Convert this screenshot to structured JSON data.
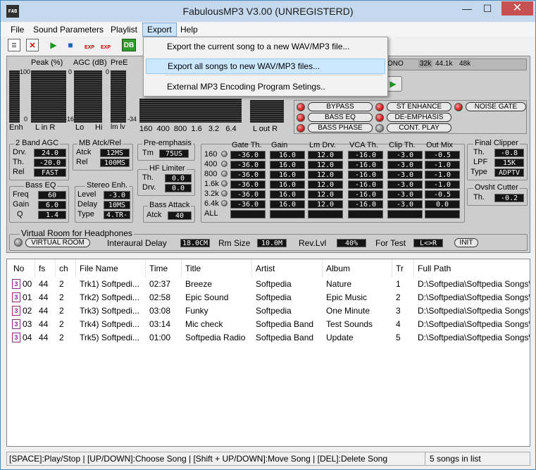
{
  "window": {
    "title": "FabulousMP3 V3.00 (UNREGISTERD)",
    "icon_text": "FAB",
    "minimize": "—",
    "maximize": "☐",
    "close": "✕"
  },
  "menu": {
    "file": "File",
    "sound": "Sound Parameters",
    "playlist": "Playlist",
    "export": "Export",
    "help": "Help"
  },
  "export_menu": {
    "item1": "Export the current song to a new WAV/MP3 file...",
    "item2": "Export all songs to new WAV/MP3 files...",
    "item3": "External MP3 Encoding Program Setings.."
  },
  "toolbar": {
    "db": "DB",
    "exp": "EXP"
  },
  "meters": {
    "peak": "Peak (%)",
    "agc": "AGC (dB)",
    "pree": "PreE",
    "s100": "100",
    "s0": "0",
    "sm16": "-16",
    "sm34": "-34",
    "enh": "Enh",
    "lin": "L  in  R",
    "lo": "Lo",
    "hi": "Hi",
    "lmlv": "lm lv",
    "bands": "160  400  800  1.6   3.2   6.4",
    "lout": "L  out  R",
    "mono": "ONO",
    "r32": "32k",
    "r441": "44.1k",
    "r48": "48k"
  },
  "switches": {
    "bypass": "BYPASS",
    "st_enhance": "ST ENHANCE",
    "noise_gate": "NOISE GATE",
    "bass_eq": "BASS EQ",
    "de_emphasis": "DE-EMPHASIS",
    "bass_phase": "BASS PHASE",
    "cont_play": "CONT. PLAY"
  },
  "agc2": {
    "title": "2 Band AGC",
    "drv_l": "Drv.",
    "drv": "24.0",
    "th_l": "Th.",
    "th": "-20.0",
    "rel_l": "Rel",
    "rel": "FAST"
  },
  "mbatck": {
    "title": "MB Atck/Rel",
    "atck_l": "Atck",
    "atck": "12MS",
    "rel_l": "Rel",
    "rel": "100MS"
  },
  "preemph": {
    "title": "Pre-emphasis",
    "tm_l": "Tm",
    "tm": "75US"
  },
  "hflim": {
    "title": "HF Limiter",
    "th_l": "Th.",
    "th": "0.0",
    "drv_l": "Drv.",
    "drv": "0.0"
  },
  "basseq": {
    "title": "Bass EQ",
    "freq_l": "Freq",
    "freq": "60",
    "gain_l": "Gain",
    "gain": "6.0",
    "q_l": "Q",
    "q": "1.4"
  },
  "stereo": {
    "title": "Stereo Enh.",
    "level_l": "Level",
    "level": "-3.0",
    "delay_l": "Delay",
    "delay": "10MS",
    "type_l": "Type",
    "type": "4.TR-"
  },
  "bassatk": {
    "title": "Bass Attack",
    "atck_l": "Atck",
    "atck": "40"
  },
  "multiband": {
    "headers": [
      "Gate Th.",
      "Gain",
      "Lm Drv.",
      "VCA Th.",
      "Clip Th.",
      "Out Mix"
    ],
    "bands": [
      "160",
      "400",
      "800",
      "1.6k",
      "3.2k",
      "6.4k",
      "ALL"
    ],
    "rows": [
      [
        "-36.0",
        "16.0",
        "12.0",
        "-16.0",
        "-3.0",
        "-0.5"
      ],
      [
        "-36.0",
        "16.0",
        "12.0",
        "-16.0",
        "-3.0",
        "-1.0"
      ],
      [
        "-36.0",
        "16.0",
        "12.0",
        "-16.0",
        "-3.0",
        "-1.0"
      ],
      [
        "-36.0",
        "16.0",
        "12.0",
        "-16.0",
        "-3.0",
        "-1.0"
      ],
      [
        "-36.0",
        "16.0",
        "12.0",
        "-16.0",
        "-3.0",
        "-0.5"
      ],
      [
        "-36.0",
        "16.0",
        "12.0",
        "-16.0",
        "-3.0",
        "0.0"
      ]
    ]
  },
  "clipper": {
    "title": "Final Clipper",
    "th_l": "Th.",
    "th": "-0.8",
    "lpf_l": "LPF",
    "lpf": "15K",
    "type_l": "Type",
    "type": "ADPTV"
  },
  "ovshoot": {
    "title": "Ovsht Cutter",
    "th_l": "Th.",
    "th": "-0.2"
  },
  "vroom": {
    "title": "Virtual Room for Headphones",
    "btn": "VIRTUAL ROOM",
    "id_l": "Interaural Delay",
    "id": "18.0CM",
    "rm_l": "Rm Size",
    "rm": "10.0M",
    "rev_l": "Rev.Lvl",
    "rev": "40%",
    "ft_l": "For Test",
    "ft": "L<>R",
    "init": "INIT"
  },
  "playlist": {
    "columns": [
      "No",
      "fs",
      "ch",
      "File Name",
      "Time",
      "Title",
      "Artist",
      "Album",
      "Tr",
      "Full Path"
    ],
    "rows": [
      [
        "00",
        "44",
        "2",
        "Trk1) Softpedi...",
        "02:37",
        "Breeze",
        "Softpedia",
        "Nature",
        "1",
        "D:\\Softpedia\\Softpedia Songs\\"
      ],
      [
        "01",
        "44",
        "2",
        "Trk2) Softpedi...",
        "02:58",
        "Epic Sound",
        "Softpedia",
        "Epic Music",
        "2",
        "D:\\Softpedia\\Softpedia Songs\\"
      ],
      [
        "02",
        "44",
        "2",
        "Trk3) Softpedi...",
        "03:08",
        "Funky",
        "Softpedia",
        "One Minute",
        "3",
        "D:\\Softpedia\\Softpedia Songs\\"
      ],
      [
        "03",
        "44",
        "2",
        "Trk4) Softpedi...",
        "03:14",
        "Mic check",
        "Softpedia Band",
        "Test Sounds",
        "4",
        "D:\\Softpedia\\Softpedia Songs\\"
      ],
      [
        "04",
        "44",
        "2",
        "Trk5) Softpedi...",
        "01:00",
        "Softpedia Radio",
        "Softpedia Band",
        "Update",
        "5",
        "D:\\Softpedia\\Softpedia Songs\\"
      ]
    ],
    "icon_glyph": "3"
  },
  "status": {
    "hint": "[SPACE]:Play/Stop | [UP/DOWN]:Choose Song | [Shift + UP/DOWN]:Move Song | [DEL]:Delete Song",
    "count": "5 songs in list"
  }
}
